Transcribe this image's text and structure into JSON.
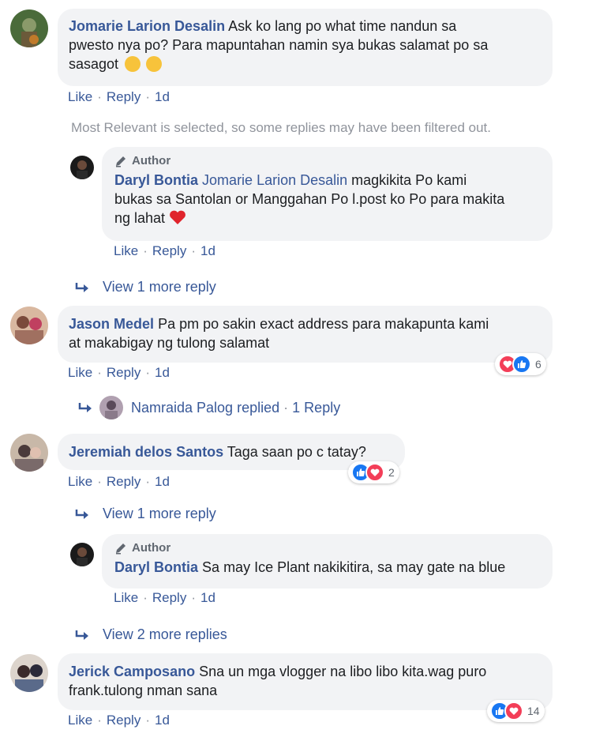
{
  "notice": "Most Relevant is selected, so some replies may have been filtered out.",
  "labels": {
    "like": "Like",
    "reply": "Reply",
    "author": "Author"
  },
  "comments": [
    {
      "name": "Jomarie Larion Desalin",
      "text_line1": "Ask ko lang po what time nandun sa",
      "text_line2": "pwesto nya po? Para mapuntahan namin sya bukas salamat po sa",
      "text_line3": "sasagot",
      "time": "1d"
    },
    {
      "name": "Jason Medel",
      "text_line1": "Pa pm po sakin exact address para makapunta kami",
      "text_line2": "at makabigay ng tulong salamat",
      "time": "1d",
      "reaction_count": "6"
    },
    {
      "name": "Jeremiah delos Santos",
      "text": "Taga saan po c tatay?",
      "time": "1d",
      "reaction_count": "2"
    },
    {
      "name": "Jerick Camposano",
      "text_line1": "Sna un mga vlogger na libo libo kita.wag puro",
      "text_line2": "frank.tulong nman sana",
      "time": "1d",
      "reaction_count": "14"
    }
  ],
  "replies": [
    {
      "name": "Daryl Bontia",
      "mention": "Jomarie Larion Desalin",
      "text_line1": "magkikita Po kami",
      "text_line2": "bukas sa Santolan or Manggahan Po l.post ko Po para makita",
      "text_line3": "ng lahat",
      "time": "1d"
    },
    {
      "name": "Daryl Bontia",
      "text": "Sa may Ice Plant nakikitira, sa may gate na blue",
      "time": "1d"
    }
  ],
  "view_more": [
    "View 1 more reply",
    "View 1 more reply",
    "View 2 more replies"
  ],
  "replied_summary": {
    "name": "Namraida Palog",
    "action": "replied",
    "sep": "·",
    "count": "1 Reply"
  },
  "colors": {
    "link": "#385898",
    "bubble": "#f2f3f5",
    "muted": "#90949c",
    "love": "#f33e58",
    "like": "#1877f2"
  }
}
